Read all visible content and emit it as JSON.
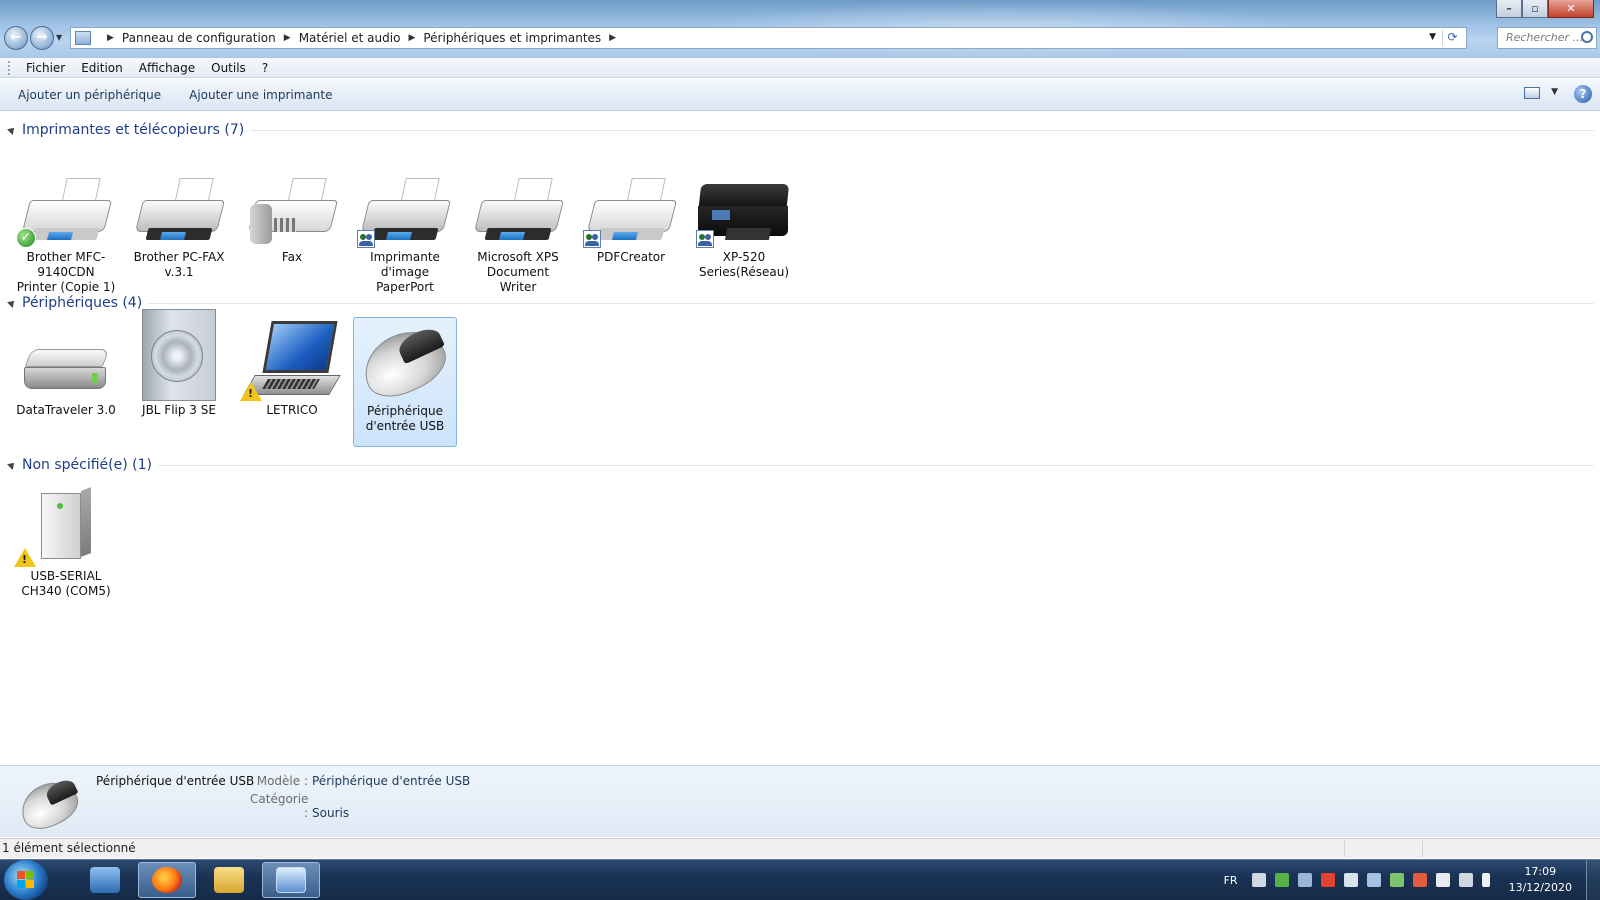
{
  "window": {
    "breadcrumb": [
      "Panneau de configuration",
      "Matériel et audio",
      "Périphériques et imprimantes"
    ],
    "search_placeholder": "Rechercher ..."
  },
  "menu": [
    "Fichier",
    "Edition",
    "Affichage",
    "Outils",
    "?"
  ],
  "commands": {
    "add_device": "Ajouter un périphérique",
    "add_printer": "Ajouter une imprimante",
    "help_label": "?"
  },
  "groups": [
    {
      "title": "Imprimantes et télécopieurs (7)"
    },
    {
      "title": "Périphériques (4)"
    },
    {
      "title": "Non spécifié(e) (1)"
    }
  ],
  "printers": [
    {
      "name": "Brother MFC-9140CDN Printer (Copie 1)",
      "icon": "printer-icon",
      "badge": "default-check"
    },
    {
      "name": "Brother PC-FAX v.3.1",
      "icon": "printer-icon",
      "badge": ""
    },
    {
      "name": "Fax",
      "icon": "fax-icon",
      "badge": ""
    },
    {
      "name": "Imprimante d'image PaperPort",
      "icon": "printer-icon",
      "badge": "shared"
    },
    {
      "name": "Microsoft XPS Document Writer",
      "icon": "printer-icon",
      "badge": ""
    },
    {
      "name": "PDFCreator",
      "icon": "printer-icon",
      "badge": "shared"
    },
    {
      "name": "XP-520 Series(Réseau)",
      "icon": "inkjet-printer-icon",
      "badge": "shared"
    }
  ],
  "devices": [
    {
      "name": "DataTraveler 3.0",
      "icon": "drive-icon",
      "badge": ""
    },
    {
      "name": "JBL Flip 3 SE",
      "icon": "speaker-icon",
      "badge": ""
    },
    {
      "name": "LETRICO",
      "icon": "laptop-icon",
      "badge": "warning"
    },
    {
      "name": "Périphérique d'entrée USB",
      "icon": "mouse-icon",
      "badge": "",
      "selected": true
    }
  ],
  "unspecified": [
    {
      "name": "USB-SERIAL CH340 (COM5)",
      "icon": "tower-icon",
      "badge": "warning"
    }
  ],
  "details": {
    "name": "Périphérique d'entrée USB",
    "model_label": "Modèle :",
    "model_value": "Périphérique d'entrée USB",
    "category_label": "Catégorie :",
    "category_value": "Souris"
  },
  "status": "1 élément sélectionné",
  "taskbar": {
    "language": "FR",
    "time": "17:09",
    "date": "13/12/2020",
    "apps": [
      "windows-explorer-icon",
      "firefox-icon",
      "file-explorer-icon",
      "control-panel-icon"
    ]
  },
  "colors": {
    "accent": "#1e3e8a",
    "selection": "#cce3fb",
    "taskbar": "#1a3355"
  }
}
